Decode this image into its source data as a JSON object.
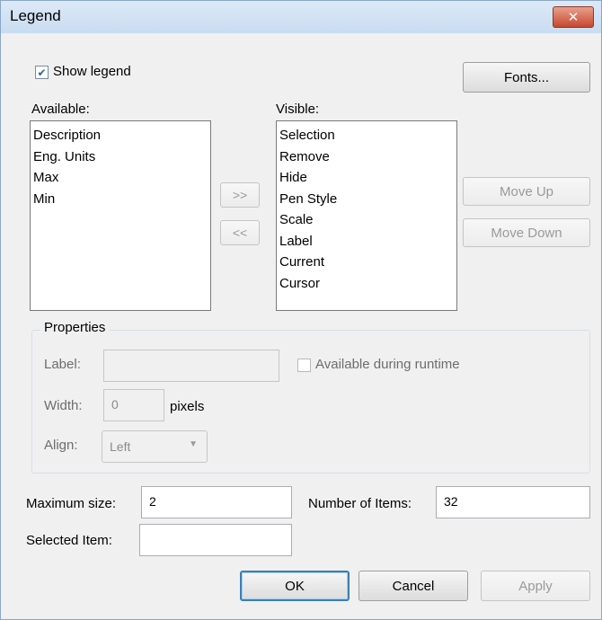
{
  "window": {
    "title": "Legend",
    "close_icon": "close-icon"
  },
  "show_legend": {
    "label": "Show legend",
    "checked": true
  },
  "fonts_button": "Fonts...",
  "available": {
    "label": "Available:",
    "items": [
      "Description",
      "Eng. Units",
      "Max",
      "Min"
    ]
  },
  "visible": {
    "label": "Visible:",
    "items": [
      "Selection",
      "Remove",
      "Hide",
      "Pen Style",
      "Scale",
      "Label",
      "Current",
      "Cursor"
    ]
  },
  "move_right_button": ">>",
  "move_left_button": "<<",
  "move_up_button": "Move Up",
  "move_down_button": "Move Down",
  "properties": {
    "title": "Properties",
    "label_label": "Label:",
    "label_value": "",
    "available_runtime_label": "Available during runtime",
    "available_runtime_checked": false,
    "width_label": "Width:",
    "width_value": "0",
    "width_unit": "pixels",
    "align_label": "Align:",
    "align_value": "Left"
  },
  "maximum_size": {
    "label": "Maximum size:",
    "value": "2"
  },
  "number_of_items": {
    "label": "Number of Items:",
    "value": "32"
  },
  "selected_item": {
    "label": "Selected Item:",
    "value": ""
  },
  "buttons": {
    "ok": "OK",
    "cancel": "Cancel",
    "apply": "Apply"
  }
}
